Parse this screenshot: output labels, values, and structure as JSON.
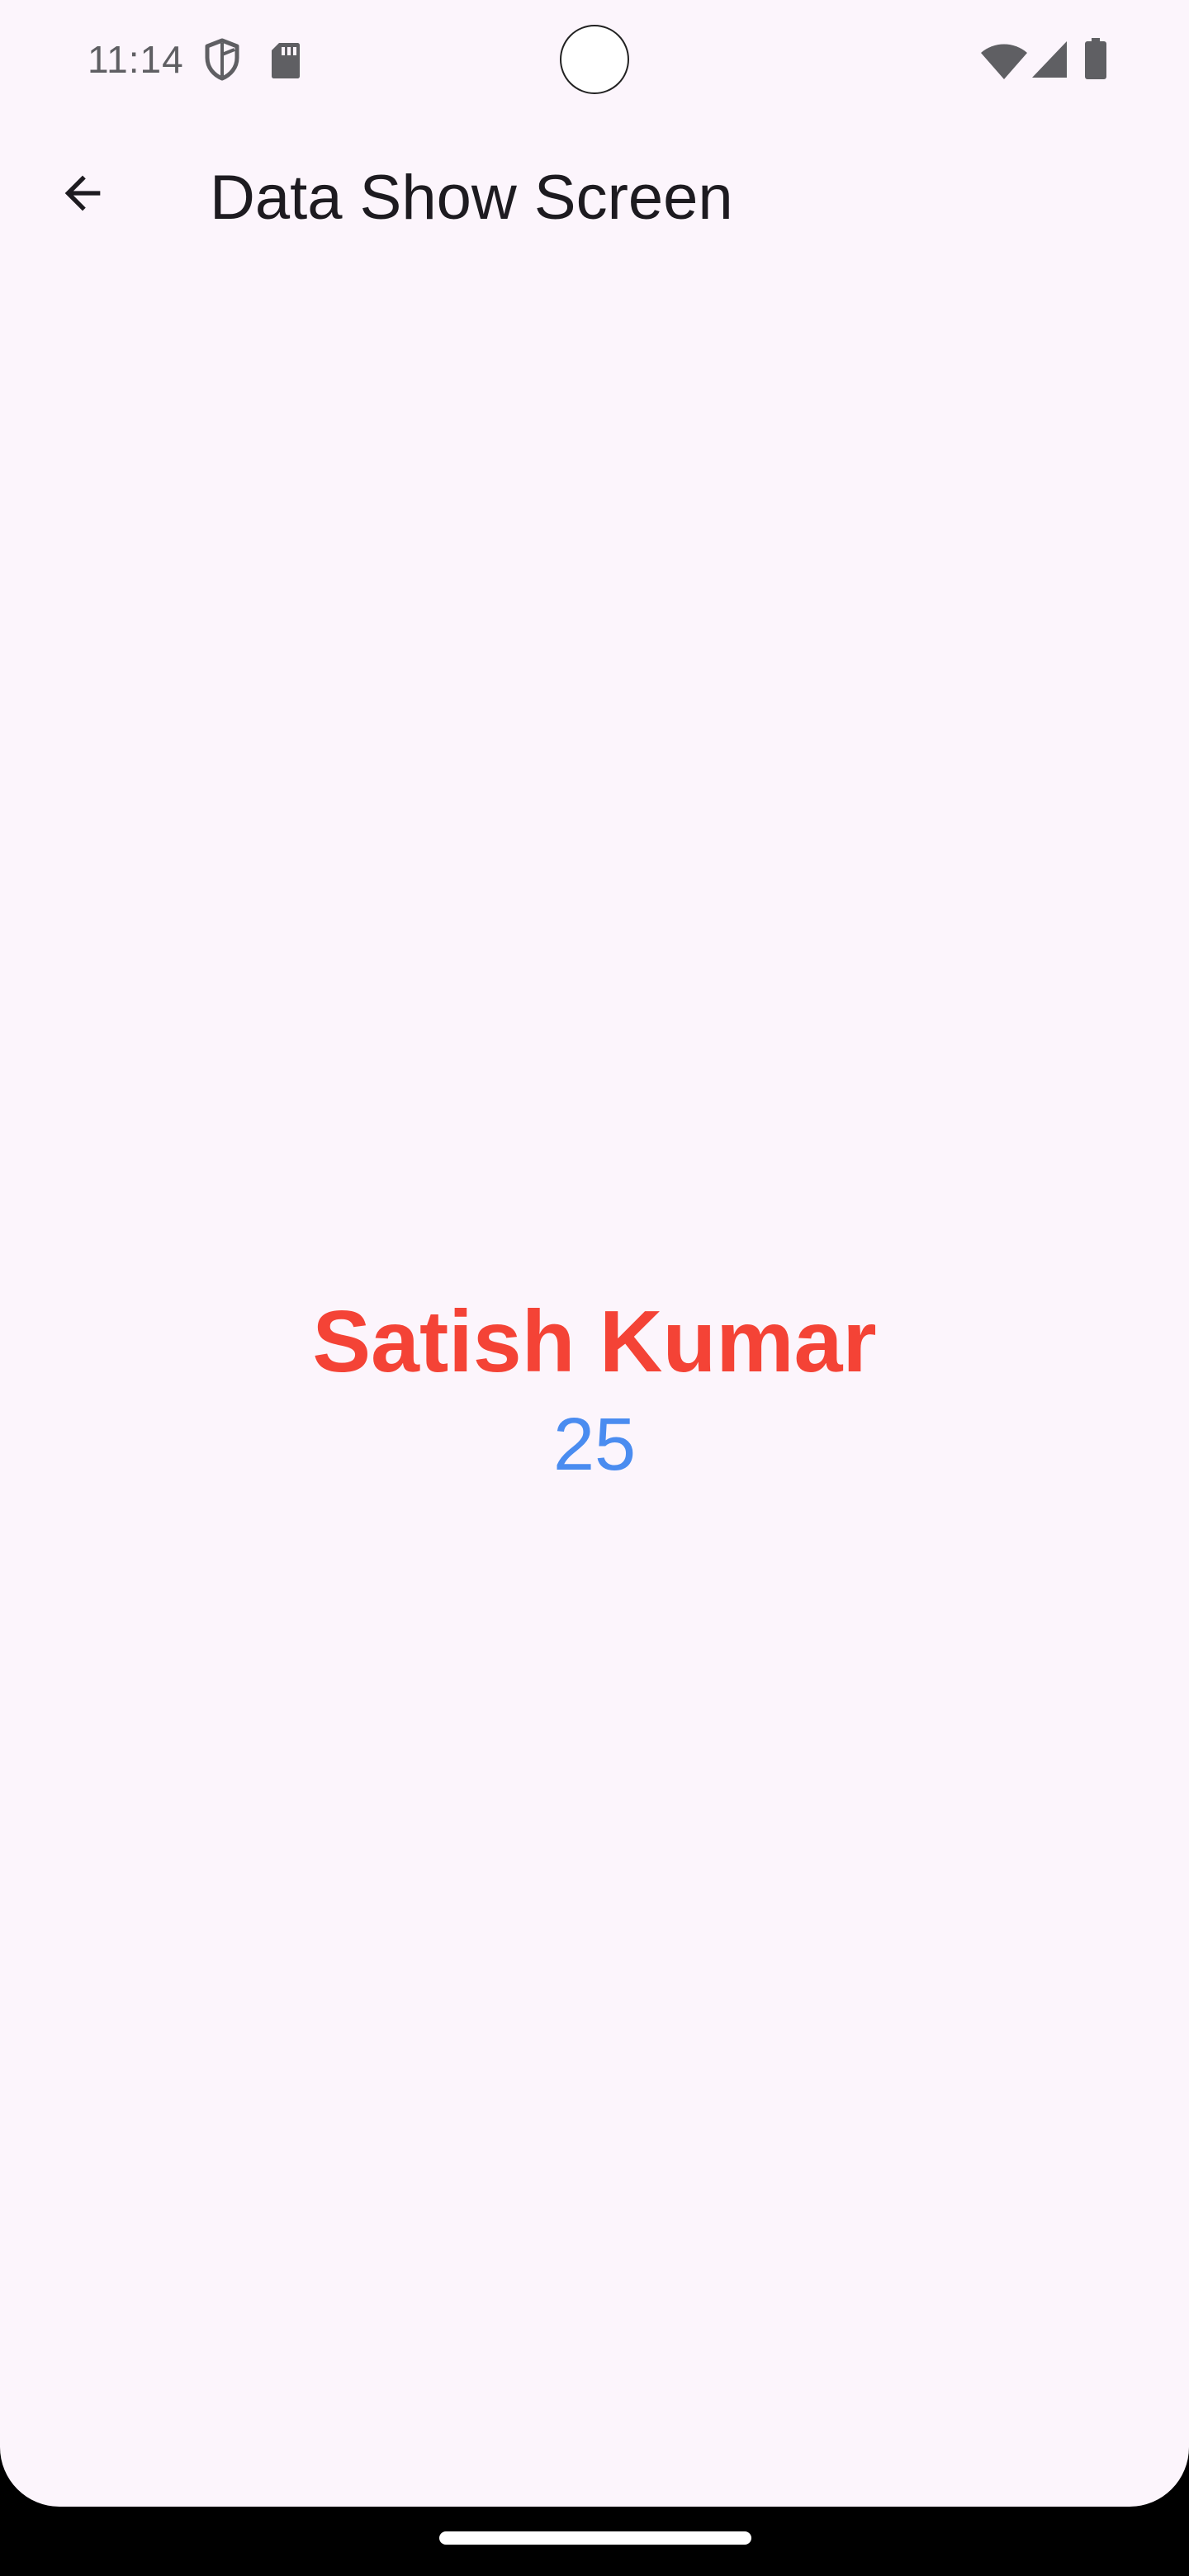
{
  "status_bar": {
    "time": "11:14",
    "icons": [
      "shield-icon",
      "sd-card-icon",
      "wifi-icon",
      "cell-signal-icon",
      "battery-icon"
    ]
  },
  "app_bar": {
    "back_icon": "arrow-back-icon",
    "title": "Data Show Screen"
  },
  "content": {
    "name": "Satish Kumar",
    "age": "25"
  },
  "colors": {
    "background": "#fcf5fc",
    "name_text": "#f44336",
    "age_text": "#4a8cf0",
    "title_text": "#1d1b20",
    "status_icons": "#5f5f63"
  }
}
